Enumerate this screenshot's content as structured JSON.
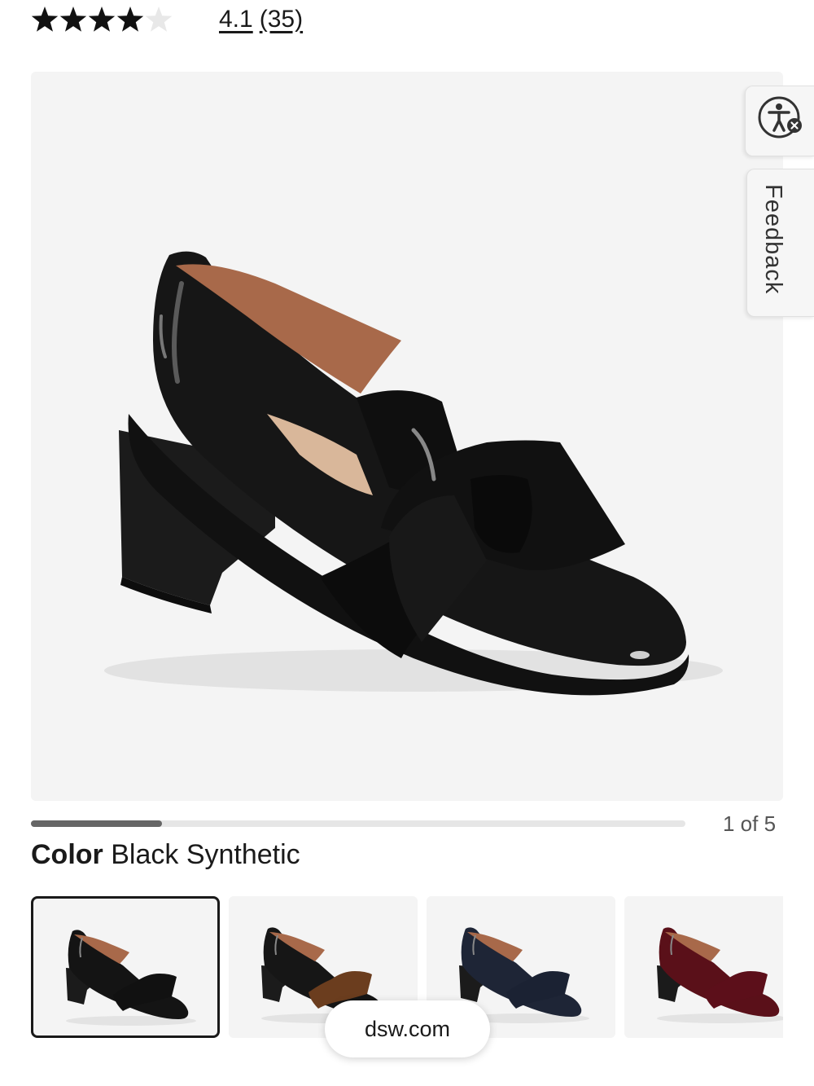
{
  "rating": {
    "value": "4.1",
    "count": "(35)",
    "stars_filled": 4,
    "stars_total": 5
  },
  "gallery": {
    "counter": "1 of 5",
    "current_index": 1,
    "total": 5,
    "progress_fraction": 0.2
  },
  "side_tabs": {
    "accessibility_icon": "accessibility-icon",
    "feedback_label": "Feedback"
  },
  "color": {
    "label": "Color",
    "value": "Black Synthetic"
  },
  "swatches": [
    {
      "name": "black",
      "upper": "#141414",
      "bow": "#111111",
      "selected": true
    },
    {
      "name": "brown",
      "upper": "#161616",
      "bow": "#6b3d1e",
      "selected": false
    },
    {
      "name": "navy",
      "upper": "#1e2536",
      "bow": "#1b2233",
      "selected": false
    },
    {
      "name": "burgundy",
      "upper": "#5a1019",
      "bow": "#5c0f1a",
      "selected": false
    }
  ],
  "browser": {
    "url": "dsw.com"
  }
}
